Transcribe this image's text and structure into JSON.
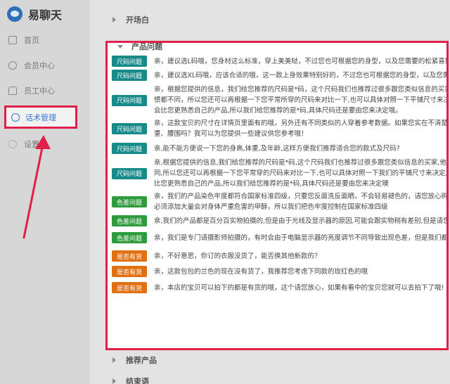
{
  "app": {
    "title": "易聊天"
  },
  "sidebar": {
    "items": [
      {
        "label": "首页",
        "icon": "home-icon"
      },
      {
        "label": "会员中心",
        "icon": "user-icon"
      },
      {
        "label": "员工中心",
        "icon": "staff-icon"
      },
      {
        "label": "话术管理",
        "icon": "chat-icon",
        "active": true
      },
      {
        "label": "设置",
        "icon": "settings-icon"
      }
    ]
  },
  "groups": {
    "g1": "开场白",
    "g2": "产品问题",
    "g3": "推荐产品",
    "g4": "结束语"
  },
  "colors": {
    "accent": "#3476cf",
    "highlight": "#e0204a",
    "teal": "#178a8a",
    "green": "#2e9b3c",
    "orange": "#e07012"
  },
  "rows": [
    {
      "tag": "尺码问题",
      "color": "teal",
      "lines": [
        "亲，建议选L码哦，您身材这么标准，穿上美美哒，不过您也可根据您的身型，以及您需要的松紧喜好来"
      ]
    },
    {
      "tag": "尺码问题",
      "color": "teal",
      "lines": [
        "亲，建议选XL码哦，应该合适的哦，这一款上身效果特别好的，不过您也可根据您的身型，以及您需要"
      ]
    },
    {
      "tag": "尺码问题",
      "color": "teal",
      "lines": [
        "亲，根据您提供的信息，我们给您推荐的尺码是*码，这个尺码我们也推荐过很多跟您类似信息的买家，他",
        "惯都不同，所以您还可以再根据一下您平常所穿的尺码来对比一下,也可以具体对照一下平铺尺寸来决定",
        "会比您更熟悉自己的产品,所以我们给您推荐的是*码,具体尺码还是要由您来决定哦。"
      ]
    },
    {
      "tag": "尺码问题",
      "color": "teal",
      "lines": [
        "亲，这款宝贝的尺寸在详情页里面有的哦，另外还有不同类似的人穿着参考数据。如果您实在不清楚自",
        "重、腰围吗？我可以为您提供一些建议供您参考哦！"
      ]
    },
    {
      "tag": "尺码问题",
      "color": "teal",
      "lines": [
        "亲,能不能方便说一下您的身高,体重,及年龄,这样方便我们推荐适合您的款式及尺码?"
      ]
    },
    {
      "tag": "尺码问题",
      "color": "teal",
      "lines": [
        "亲,根据您提供的信息,我们给您推荐的尺码是*码,这个尺码我们也推荐过很多跟您类似信息的买家,他们",
        "同,所以您还可以再根据一下您平常穿的尺码来对比一下,也可以具体对照一下我们的平铺尺寸来决定,",
        "比您更熟悉自己的产品,所以我们给您推荐的是*码,具体尺码还是要由您来决定噢"
      ]
    },
    {
      "tag": "色差问题",
      "color": "green",
      "lines": [
        "亲，我们的产品染色牢度都符合国家标准四级，只要您反面洗反面晒，不会轻易褪色的，请您放心购",
        "必须添加大量会对身体严重危害的甲醇，所以我们把色牢度控制在国家标准四级"
      ]
    },
    {
      "tag": "色差问题",
      "color": "green",
      "lines": [
        "亲,我们的产品都是百分百实物拍摄的,但是由于光线及显示器的原因,可能会跟实物稍有差别,但是请您放"
      ]
    },
    {
      "tag": "色差问题",
      "color": "green",
      "lines": [
        "亲，我们是专门请摄影师拍摄的，有时会由于电脑显示器的亮度调节不同导致出现色差，但是我们都是"
      ]
    },
    {
      "tag": "是否有货",
      "color": "orange",
      "lines": [
        "亲，不好意思，你订的衣服没货了，能否换其他新款的？"
      ]
    },
    {
      "tag": "是否有货",
      "color": "orange",
      "lines": [
        "亲，这款包包的兰色的现在没有货了，我推荐您考虑下同款的玫红色的哦"
      ]
    },
    {
      "tag": "是否有货",
      "color": "orange",
      "lines": [
        "亲，本店的宝贝可以拍下的都是有货的哦，这个请您放心，如果有看中的宝贝您就可以去拍下了哦!"
      ]
    }
  ]
}
